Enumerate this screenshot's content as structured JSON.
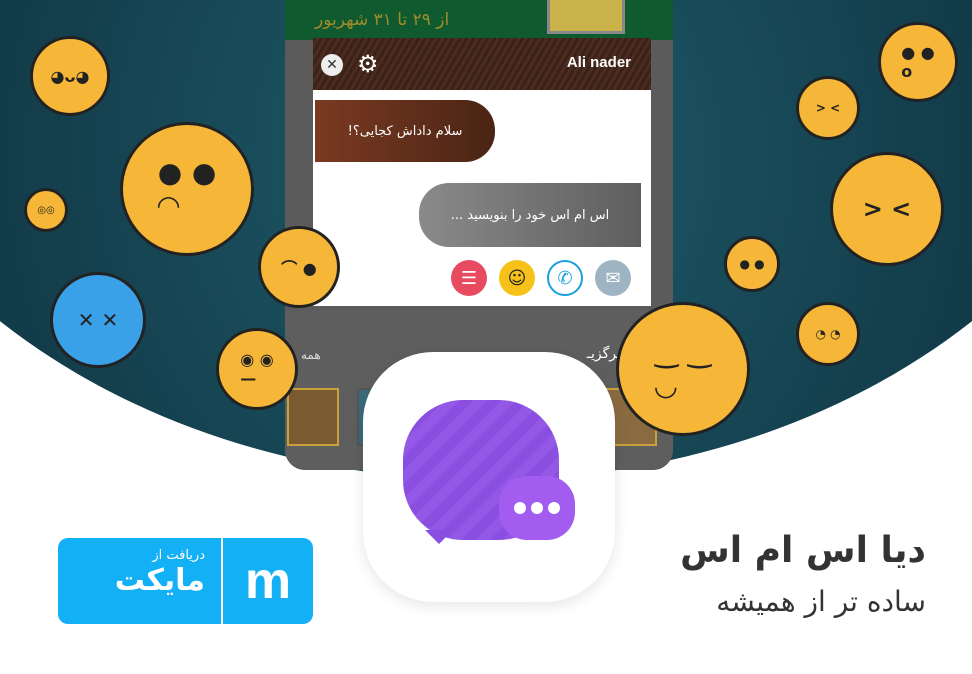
{
  "phone": {
    "banner_text": "از ۲۹ تا ۳۱ شهریور",
    "popup": {
      "contact_name": "Ali nader",
      "close_icon": "close-icon",
      "settings_icon": "gear-icon",
      "incoming_message": "سلام داداش کجایی؟!",
      "compose_placeholder": "اس ام اس خود را بنویسید ...",
      "actions": [
        {
          "icon": "list-icon",
          "color": "#e84a5f"
        },
        {
          "icon": "emoji-icon",
          "color": "#f6c21a"
        },
        {
          "icon": "phone-icon",
          "color": "#1aa0e0"
        },
        {
          "icon": "send-icon",
          "color": "#8aa0b0"
        }
      ]
    },
    "store": {
      "section_title": "ی تازهٔ برگزیـ",
      "more_label": "همه"
    }
  },
  "app": {
    "title": "دیا اس ام اس",
    "tagline": "ساده تر از همیشه",
    "accent": "#9358e6"
  },
  "badge": {
    "small": "دریافت از",
    "big": "مایکت",
    "logo": "m",
    "color": "#14b0f5"
  }
}
